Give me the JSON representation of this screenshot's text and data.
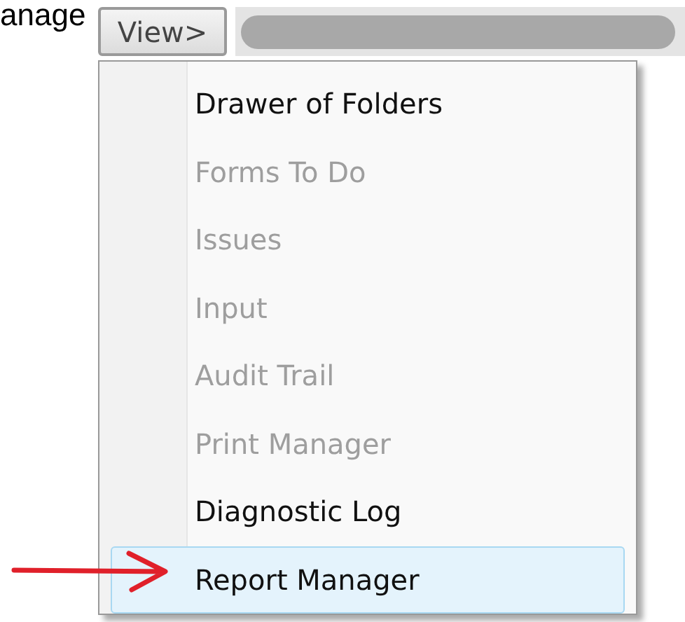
{
  "header_text": "anage",
  "view_button": {
    "label": "View>"
  },
  "menu": {
    "items": [
      {
        "label": "Drawer of Folders",
        "disabled": false,
        "selected": false
      },
      {
        "label": "Forms To Do",
        "disabled": true,
        "selected": false
      },
      {
        "label": "Issues",
        "disabled": true,
        "selected": false
      },
      {
        "label": "Input",
        "disabled": true,
        "selected": false
      },
      {
        "label": "Audit Trail",
        "disabled": true,
        "selected": false
      },
      {
        "label": "Print Manager",
        "disabled": true,
        "selected": false
      },
      {
        "label": "Diagnostic Log",
        "disabled": false,
        "selected": false
      },
      {
        "label": "Report Manager",
        "disabled": false,
        "selected": true
      }
    ]
  }
}
